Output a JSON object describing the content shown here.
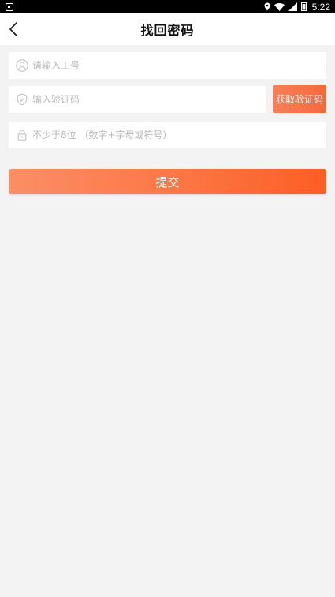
{
  "status_bar": {
    "time": "5:22",
    "icons": [
      "app-notification-icon",
      "location-icon",
      "wifi-icon",
      "signal-icon",
      "battery-icon"
    ]
  },
  "header": {
    "title": "找回密码",
    "back_icon": "chevron-left-icon"
  },
  "form": {
    "employee_id": {
      "placeholder": "请输入工号",
      "value": "",
      "icon": "user-icon"
    },
    "verification_code": {
      "placeholder": "输入验证码",
      "value": "",
      "icon": "shield-check-icon"
    },
    "get_code_label": "获取验证码",
    "password": {
      "placeholder": "不少于8位 （数字+字母或符号）",
      "value": "",
      "icon": "lock-icon"
    },
    "submit_label": "提交"
  },
  "colors": {
    "accent": "#fc7040",
    "background": "#f3f3f3",
    "placeholder": "#b9b9b9"
  }
}
